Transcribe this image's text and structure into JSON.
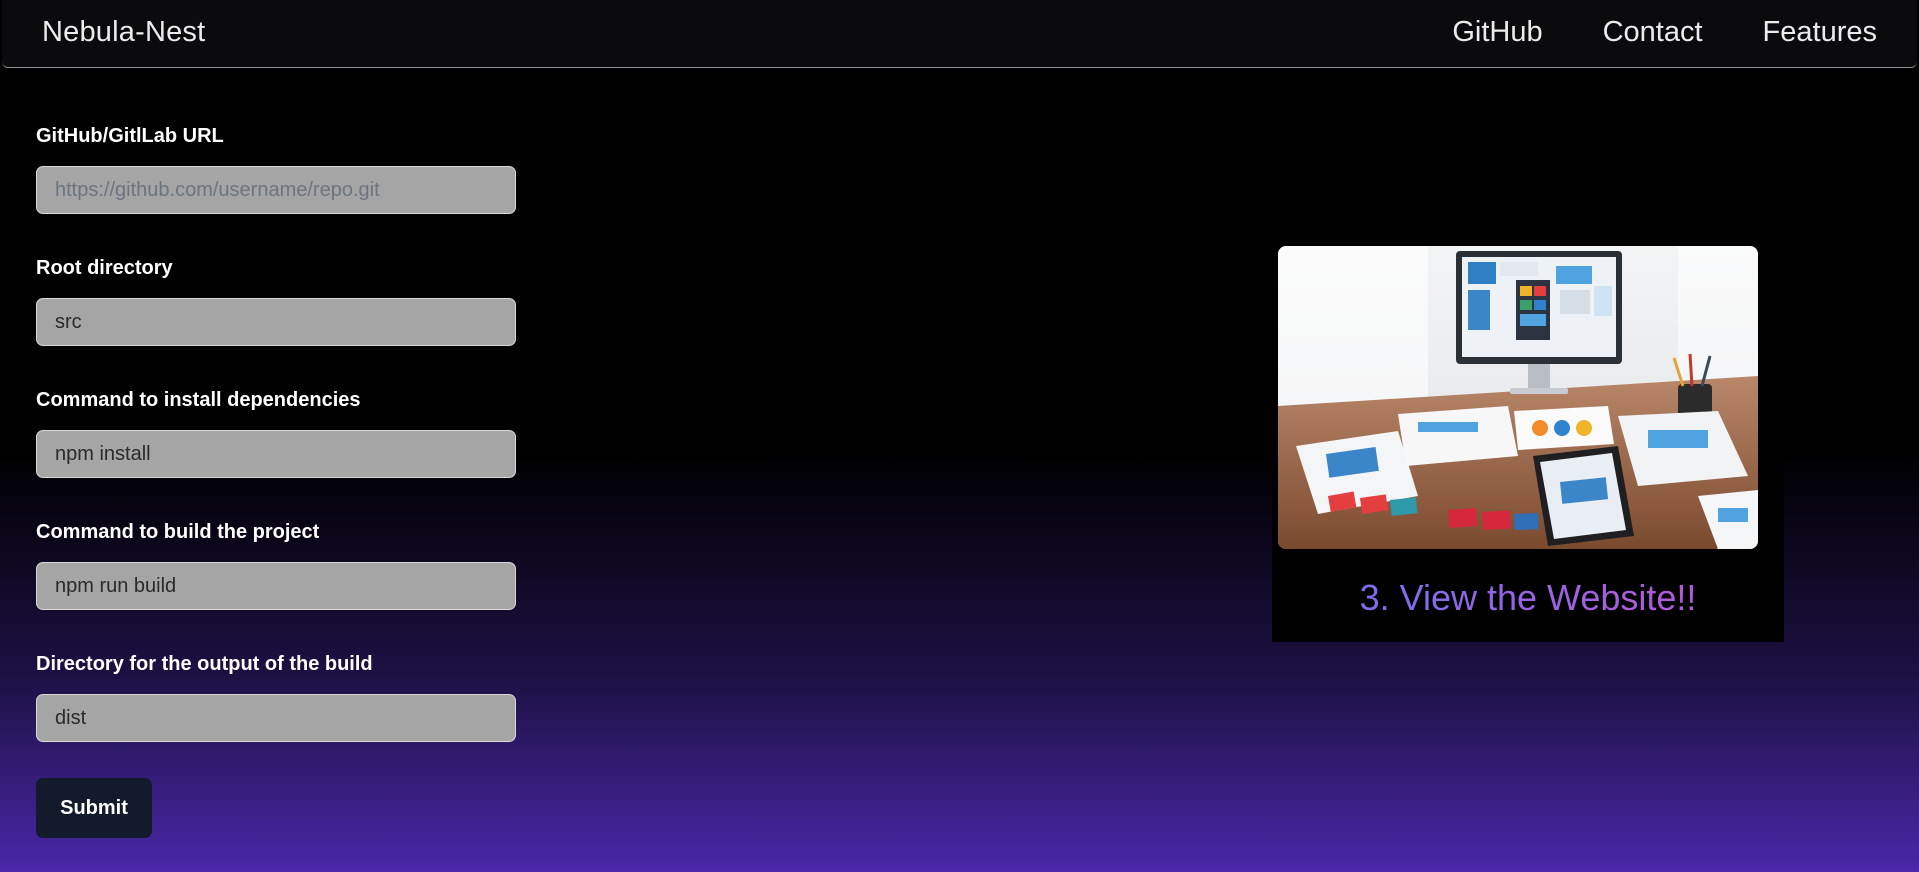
{
  "navbar": {
    "brand": "Nebula-Nest",
    "links": [
      "GitHub",
      "Contact",
      "Features"
    ]
  },
  "form": {
    "fields": [
      {
        "label": "GitHub/GitlLab URL",
        "value": "",
        "placeholder": "https://github.com/username/repo.git"
      },
      {
        "label": "Root directory",
        "value": "src",
        "placeholder": ""
      },
      {
        "label": "Command to install dependencies",
        "value": "npm install",
        "placeholder": ""
      },
      {
        "label": "Command to build the project",
        "value": "npm run build",
        "placeholder": ""
      },
      {
        "label": "Directory for the output of the build",
        "value": "dist",
        "placeholder": ""
      }
    ],
    "submit_label": "Submit"
  },
  "feature": {
    "caption": "3. View the Website!!"
  },
  "colors": {
    "background_top": "#000000",
    "background_bottom": "#4a28a8",
    "input_background": "#a5a5a5",
    "submit_background": "#131a2b",
    "caption_gradient_start": "#7c6ef0",
    "caption_gradient_end": "#b35ad8"
  }
}
